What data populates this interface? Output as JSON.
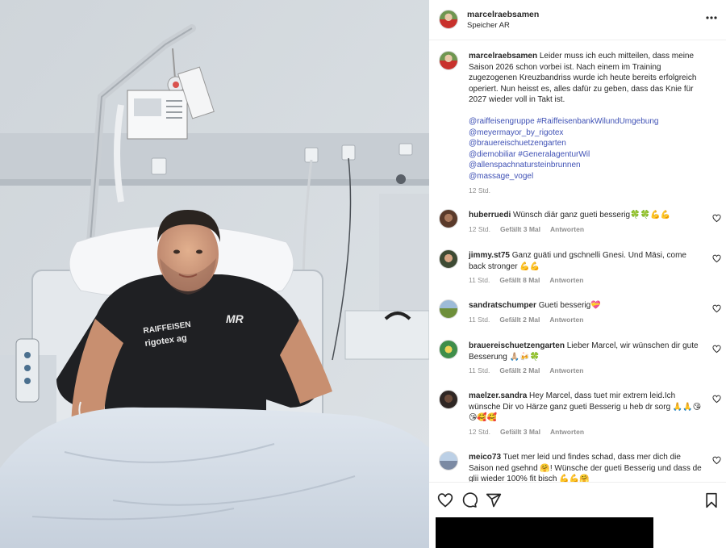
{
  "post": {
    "username": "marcelraebsamen",
    "location": "Speicher AR",
    "caption_user": "marcelraebsamen",
    "caption_body": "Leider muss ich euch mitteilen, dass meine Saison 2026 schon vorbei ist. Nach einem im Training zugezogenen Kreuzbandriss wurde ich heute bereits erfolgreich operiert. Nun heisst es, alles dafür zu geben, dass das Knie für 2027 wieder voll in Takt ist.",
    "tags": [
      "@raiffeisengruppe #RaiffeisenbankWilundUmgebung",
      "@meyermayor_by_rigotex",
      "@brauereischuetzengarten",
      "@diemobiliar #GeneralagenturWil",
      "@allenspachnatursteinbrunnen",
      "@massage_vogel"
    ],
    "time": "12 Std."
  },
  "comments": [
    {
      "user": "huberruedi",
      "text": "Wünsch diär ganz gueti besserig🍀🍀💪💪",
      "time": "12 Std.",
      "likes": "Gefällt 3 Mal",
      "reply": "Antworten"
    },
    {
      "user": "jimmy.st75",
      "text": "Ganz guäti und gschnelli Gnesi. Und Mäsi, come back stronger 💪💪",
      "time": "11 Std.",
      "likes": "Gefällt 8 Mal",
      "reply": "Antworten"
    },
    {
      "user": "sandratschumper",
      "text": "Gueti besserig💝",
      "time": "11 Std.",
      "likes": "Gefällt 2 Mal",
      "reply": "Antworten"
    },
    {
      "user": "brauereischuetzengarten",
      "text": "Lieber Marcel, wir wünschen dir gute Besserung 🙏🏼🍻🍀",
      "time": "11 Std.",
      "likes": "Gefällt 2 Mal",
      "reply": "Antworten"
    },
    {
      "user": "maelzer.sandra",
      "text": "Hey Marcel, dass tuet mir extrem leid.Ich wünsche Dir vo Härze ganz gueti Besserig u heb dr sorg 🙏🙏😘😘🥰🥰",
      "time": "12 Std.",
      "likes": "Gefällt 3 Mal",
      "reply": "Antworten"
    },
    {
      "user": "meico73",
      "text": "Tuet mer leid und findes schad, dass mer dich die Saison ned gsehnd 🤗! Wünsche der gueti Besserig und dass de glii wieder 100% fit bisch 💪💪🤗",
      "time": "",
      "likes": "",
      "reply": ""
    }
  ],
  "photo": {
    "shirt_brand_1": "RAIFFEISEN",
    "shirt_brand_2": "rigotex ag",
    "shirt_logo": "MR"
  },
  "icons": {
    "more": "more-horizontal-icon",
    "like": "heart-icon",
    "comment": "comment-icon",
    "share": "share-icon",
    "save": "bookmark-icon"
  }
}
